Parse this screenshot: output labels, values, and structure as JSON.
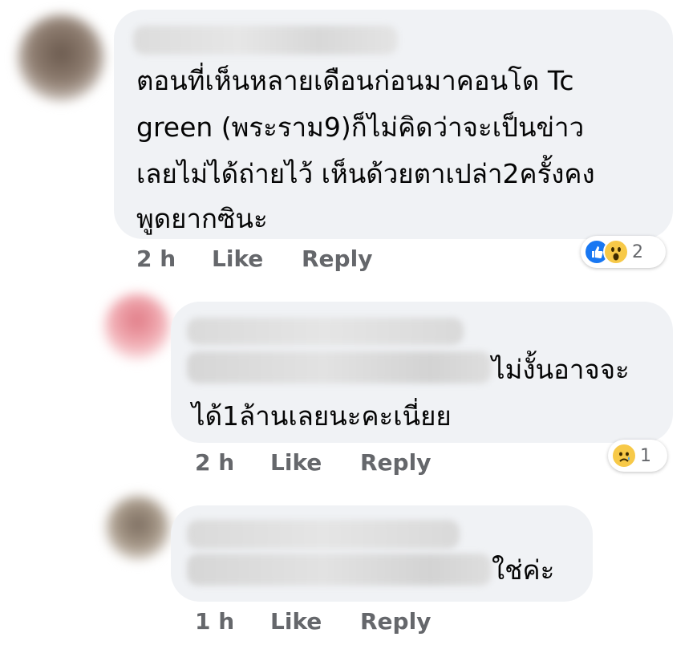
{
  "comments": [
    {
      "text_lines": [
        "ตอนที่เห็นหลายเดือนก่อนมาคอนโด Tc",
        "green (พระราม9)ก็ไม่คิดว่าจะเป็นข่าว",
        "เลยไม่ได้ถ่ายไว้ เห็นด้วยตาเปล่า2ครั้งคง",
        "พูดยากซินะ"
      ],
      "time": "2 h",
      "like_label": "Like",
      "reply_label": "Reply",
      "reaction_count": "2",
      "reaction_icons": [
        "like-icon",
        "wow-icon"
      ]
    },
    {
      "text_lines": [
        "ไม่งั้นอาจจะ",
        "ได้1ล้านเลยนะคะเนี่ยย"
      ],
      "time": "2 h",
      "like_label": "Like",
      "reply_label": "Reply",
      "reaction_count": "1",
      "reaction_icons": [
        "sad-icon"
      ]
    },
    {
      "text_lines": [
        "ใช่ค่ะ"
      ],
      "time": "1 h",
      "like_label": "Like",
      "reply_label": "Reply"
    }
  ],
  "colors": {
    "bubble": "#f0f2f5",
    "meta_text": "#65676b",
    "like_blue": "#1877f2",
    "emoji_yellow": "#f7c948"
  }
}
